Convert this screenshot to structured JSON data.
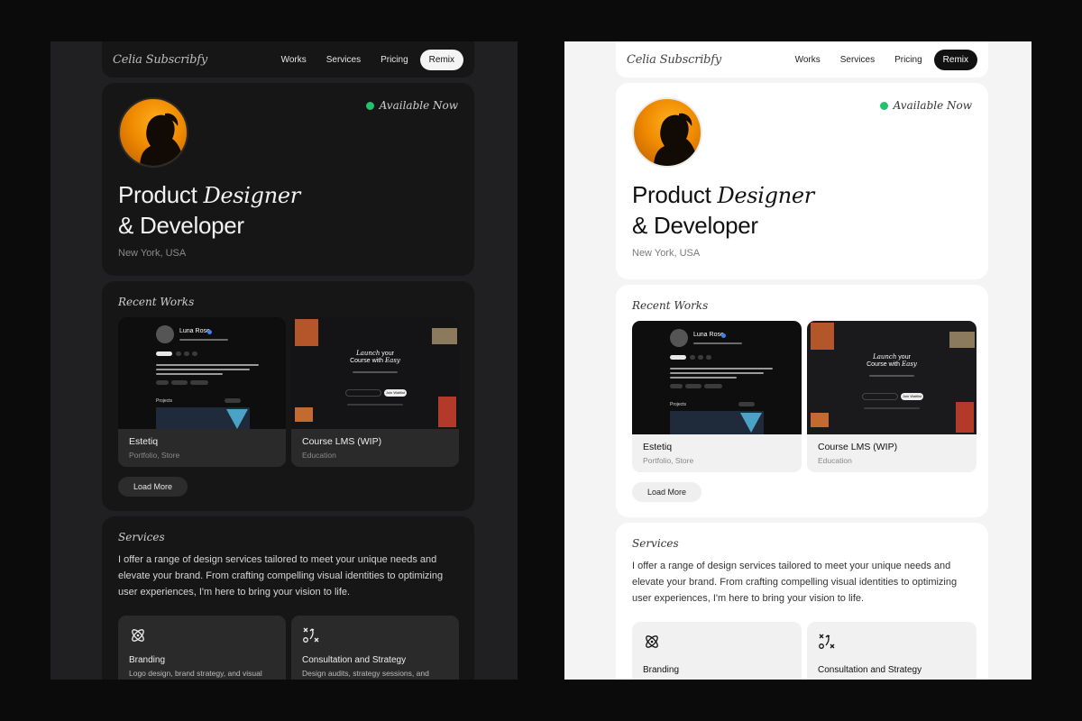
{
  "brand": "Celia Subscribfy",
  "nav": {
    "links": [
      "Works",
      "Services",
      "Pricing"
    ],
    "remix": "Remix"
  },
  "hero": {
    "available": "Available Now",
    "headline_plain": "Product ",
    "headline_serif": "Designer",
    "headline_line2": "& Developer",
    "location": "New York, USA"
  },
  "works": {
    "title": "Recent Works",
    "items": [
      {
        "title": "Estetiq",
        "subtitle": "Portfolio, Store"
      },
      {
        "title": "Course LMS (WIP)",
        "subtitle": "Education"
      }
    ],
    "load_more": "Load More",
    "thumb_a": {
      "name": "Luna Rose",
      "projects": "Projects"
    },
    "thumb_b": {
      "line1": "Launch",
      "line1b": "your",
      "line2": "Course with",
      "line2b": "Easy",
      "button": "Join Waitlist"
    }
  },
  "services": {
    "title": "Services",
    "description": "I offer a range of design services tailored to meet your unique needs and elevate your brand. From crafting compelling visual identities to optimizing user experiences, I'm here to bring your vision to life.",
    "items": [
      {
        "title": "Branding",
        "subtitle": "Logo design, brand strategy, and visual"
      },
      {
        "title": "Consultation and Strategy",
        "subtitle": "Design audits, strategy sessions, and"
      }
    ]
  },
  "colors": {
    "accent_available": "#21c26b",
    "avatar": "#f08a00"
  },
  "icons": [
    "atom-icon",
    "strategy-icon",
    "verified-icon"
  ]
}
